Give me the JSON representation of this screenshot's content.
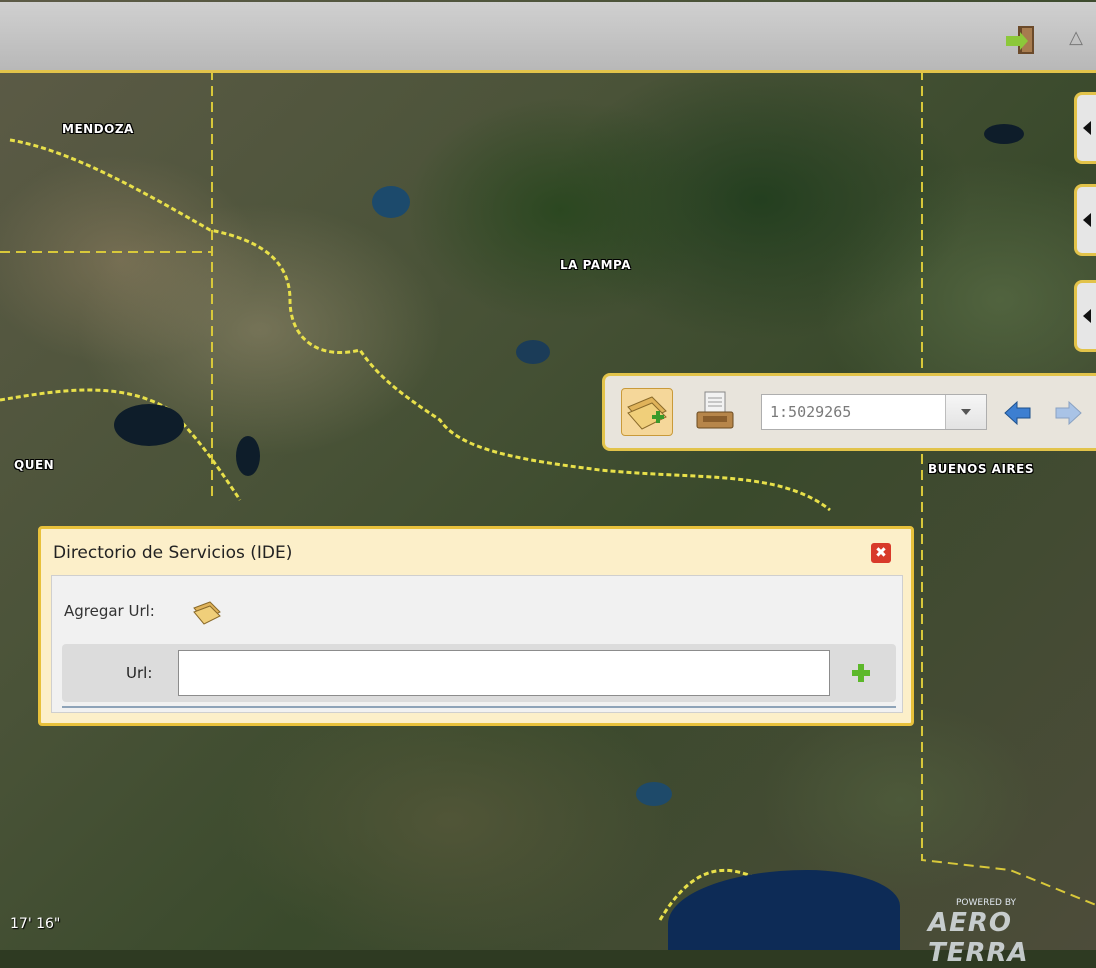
{
  "map": {
    "labels": {
      "mendoza": "MENDOZA",
      "la_pampa": "LA PAMPA",
      "neuquen": "QUEN",
      "buenos_aires": "BUENOS AIRES"
    },
    "coordinates": "17' 16\"",
    "powered_by": "POWERED BY",
    "brand": "AERO TERRA"
  },
  "toolbar": {
    "exit_icon": "exit-door-icon",
    "collapse_icon": "collapse-up-icon",
    "collapse_glyph": "△"
  },
  "side_tabs": [
    {
      "icon": "chevron-left-icon"
    },
    {
      "icon": "chevron-left-icon"
    },
    {
      "icon": "chevron-left-icon"
    }
  ],
  "scale_bar": {
    "scale_value": "1:5029265",
    "add_layer_icon": "add-layer-icon",
    "print_icon": "print-icon",
    "back_icon": "arrow-left-icon",
    "forward_icon": "arrow-right-icon"
  },
  "dialog": {
    "title": "Directorio de Servicios (IDE)",
    "close_glyph": "✖",
    "add_url_label": "Agregar Url:",
    "url_label": "Url:",
    "url_value": "",
    "url_placeholder": ""
  },
  "colors": {
    "accent": "#e2c34a",
    "dialog_bg": "#fcefc9",
    "close_red": "#d83a2a",
    "add_green": "#5cb82a",
    "arrow_blue": "#3d7fd1"
  }
}
